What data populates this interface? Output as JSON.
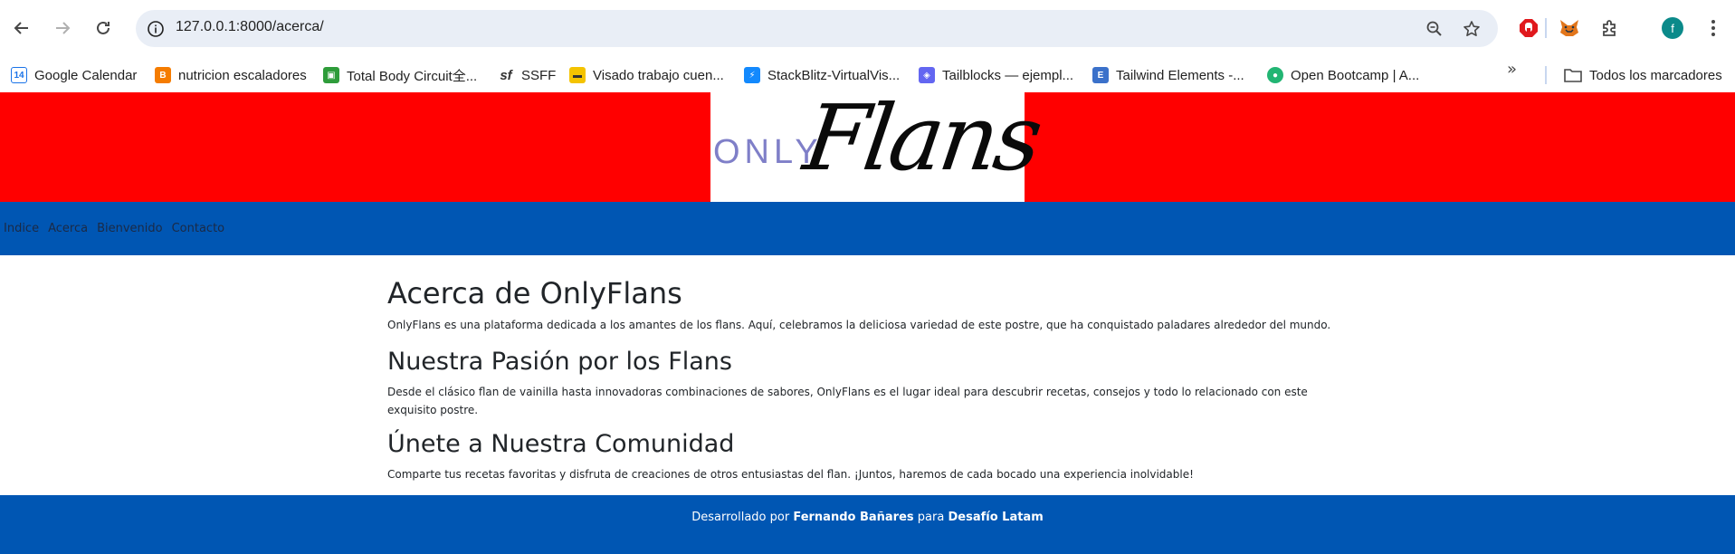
{
  "browser": {
    "url": "127.0.0.1:8000/acerca/",
    "profile_initial": "f",
    "bookmarks": [
      {
        "label": "Google Calendar",
        "icon": "calendar-icon",
        "color": "#1a73e8"
      },
      {
        "label": "nutricion escaladores",
        "icon": "blogger-icon",
        "color": "#f57c00"
      },
      {
        "label": "Total Body Circuit全...",
        "icon": "total-body-icon",
        "color": "#2e9c3a"
      },
      {
        "label": "SSFF",
        "icon": "sf-icon",
        "color": "#333333"
      },
      {
        "label": "Visado trabajo cuen...",
        "icon": "visado-icon",
        "color": "#f4c300"
      },
      {
        "label": "StackBlitz-VirtualVis...",
        "icon": "stackblitz-icon",
        "color": "#1389fd"
      },
      {
        "label": "Tailblocks — ejempl...",
        "icon": "tailblocks-icon",
        "color": "#6366f1"
      },
      {
        "label": "Tailwind Elements -...",
        "icon": "tailwind-elements-icon",
        "color": "#3b71ca"
      },
      {
        "label": "Open Bootcamp | A...",
        "icon": "open-bootcamp-icon",
        "color": "#22b573"
      }
    ],
    "all_bookmarks_label": "Todos los marcadores"
  },
  "header": {
    "logo_only": "ONLY",
    "logo_flans": "Flans",
    "header_color": "#ff0000"
  },
  "nav": {
    "items": [
      "Indice",
      "Acerca",
      "Bienvenido",
      "Contacto"
    ],
    "color": "#0056b3"
  },
  "main": {
    "sections": [
      {
        "title": "Acerca de OnlyFlans",
        "text": "OnlyFlans es una plataforma dedicada a los amantes de los flans. Aquí, celebramos la deliciosa variedad de este postre, que ha conquistado paladares alrededor del mundo."
      },
      {
        "title": "Nuestra Pasión por los Flans",
        "text": "Desde el clásico flan de vainilla hasta innovadoras combinaciones de sabores, OnlyFlans es el lugar ideal para descubrir recetas, consejos y todo lo relacionado con este exquisito postre."
      },
      {
        "title": "Únete a Nuestra Comunidad",
        "text": "Comparte tus recetas favoritas y disfruta de creaciones de otros entusiastas del flan. ¡Juntos, haremos de cada bocado una experiencia inolvidable!"
      }
    ]
  },
  "footer": {
    "prefix": "Desarrollado por",
    "author": "Fernando Bañares",
    "middle": "para",
    "org": "Desafío Latam"
  }
}
